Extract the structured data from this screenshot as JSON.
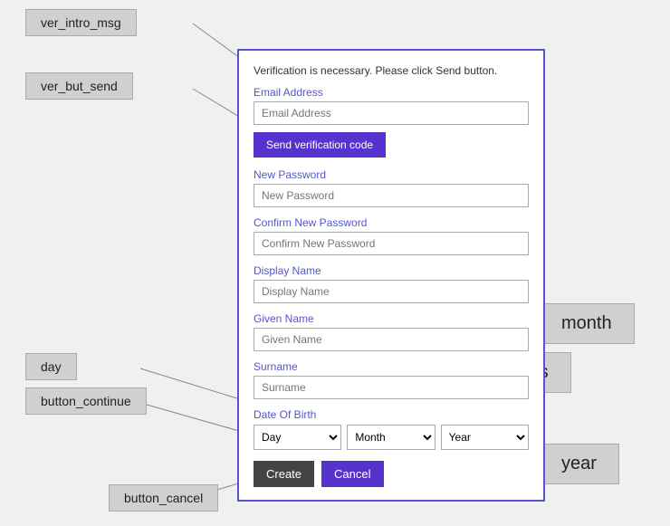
{
  "annotations": {
    "ver_intro_msg": "ver_intro_msg",
    "ver_but_send": "ver_but_send",
    "day": "day",
    "month": "month",
    "months": "months",
    "year": "year",
    "button_continue": "button_continue",
    "button_cancel": "button_cancel"
  },
  "form": {
    "intro_line1": "Verification is necessary. Please click Send button.",
    "email_label": "Email Address",
    "email_placeholder": "Email Address",
    "send_btn_label": "Send verification code",
    "new_password_label": "New Password",
    "new_password_placeholder": "New Password",
    "confirm_password_label": "Confirm New Password",
    "confirm_password_placeholder": "Confirm New Password",
    "display_name_label": "Display Name",
    "display_name_placeholder": "Display Name",
    "given_name_label": "Given Name",
    "given_name_placeholder": "Given Name",
    "surname_label": "Surname",
    "surname_placeholder": "Surname",
    "dob_label": "Date Of Birth",
    "day_default": "Day",
    "month_default": "Month",
    "year_default": "Year",
    "create_btn": "Create",
    "cancel_btn": "Cancel"
  }
}
